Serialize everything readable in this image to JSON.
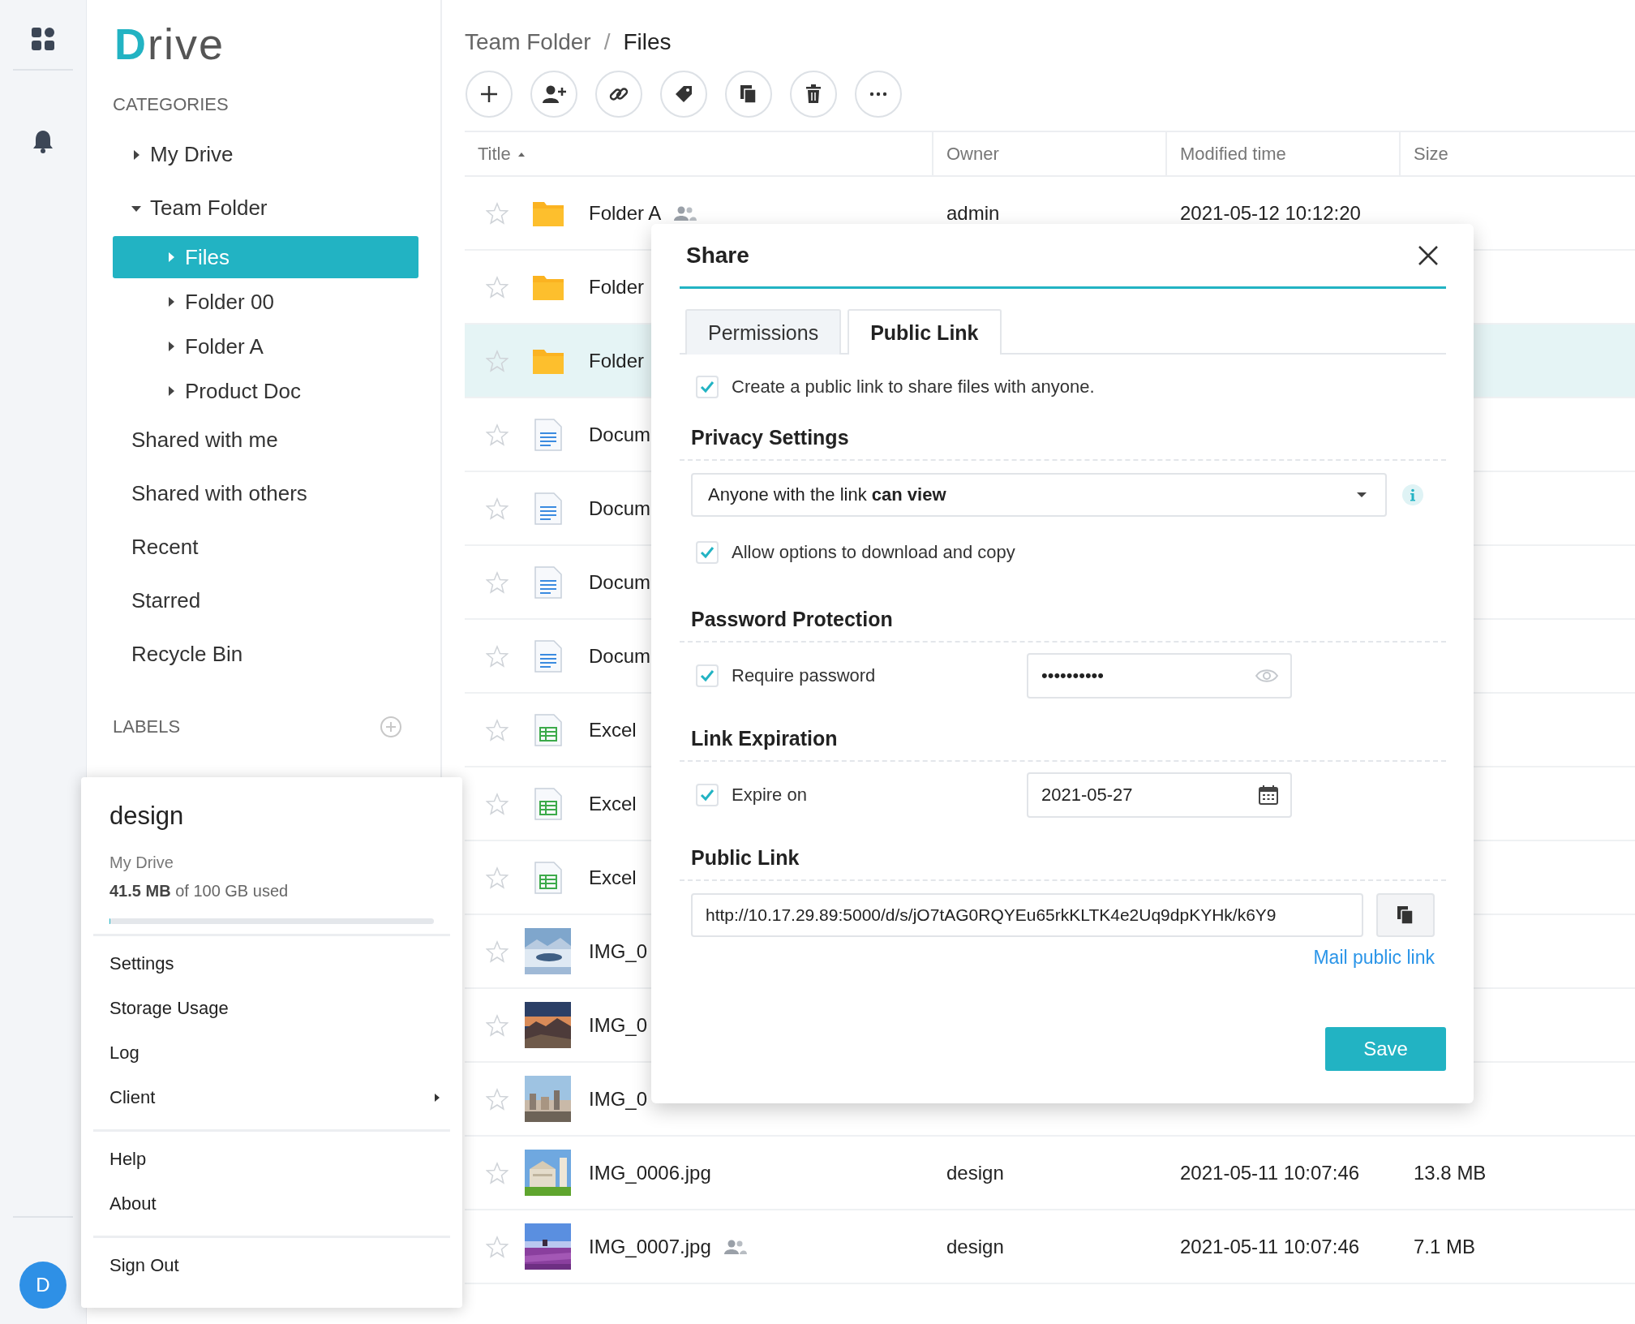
{
  "app": {
    "logo": "Drive",
    "avatar": "D"
  },
  "sidebar": {
    "categories_heading": "CATEGORIES",
    "labels_heading": "LABELS",
    "items": [
      {
        "label": "My Drive",
        "kind": "folder",
        "expanded": false,
        "selected": false
      },
      {
        "label": "Team Folder",
        "kind": "folder",
        "expanded": true,
        "selected": false,
        "children": [
          {
            "label": "Files",
            "kind": "folder",
            "expanded": false,
            "selected": true
          },
          {
            "label": "Folder 00",
            "kind": "folder",
            "expanded": false,
            "selected": false
          },
          {
            "label": "Folder A",
            "kind": "folder",
            "expanded": false,
            "selected": false
          },
          {
            "label": "Product Doc",
            "kind": "folder",
            "expanded": false,
            "selected": false
          }
        ]
      },
      {
        "label": "Shared with me",
        "kind": "link",
        "selected": false
      },
      {
        "label": "Shared with others",
        "kind": "link",
        "selected": false
      },
      {
        "label": "Recent",
        "kind": "link",
        "selected": false
      },
      {
        "label": "Starred",
        "kind": "link",
        "selected": false
      },
      {
        "label": "Recycle Bin",
        "kind": "link",
        "selected": false
      }
    ]
  },
  "breadcrumb": {
    "items": [
      "Team Folder",
      "Files"
    ],
    "separator": "/"
  },
  "toolbar": [
    {
      "kind": "add"
    },
    {
      "kind": "add-user"
    },
    {
      "kind": "link"
    },
    {
      "kind": "tag"
    },
    {
      "kind": "copy"
    },
    {
      "kind": "delete"
    },
    {
      "kind": "more"
    }
  ],
  "table": {
    "columns": [
      {
        "label": "Title",
        "sorted": true
      },
      {
        "label": "Owner",
        "sorted": false
      },
      {
        "label": "Modified time",
        "sorted": false
      },
      {
        "label": "Size",
        "sorted": false
      }
    ],
    "rows": [
      {
        "kind": "folder",
        "title": "Folder A",
        "shared": true,
        "owner": "admin",
        "modified": "2021-05-12 10:12:20",
        "selected": false
      },
      {
        "kind": "folder",
        "title": "Folder",
        "selected": false
      },
      {
        "kind": "folder",
        "title": "Folder",
        "selected": true
      },
      {
        "kind": "document",
        "title": "Docum",
        "selected": false
      },
      {
        "kind": "document",
        "title": "Docum",
        "selected": false
      },
      {
        "kind": "document",
        "title": "Docum",
        "selected": false
      },
      {
        "kind": "document",
        "title": "Docum",
        "selected": false
      },
      {
        "kind": "sheet",
        "title": "Excel",
        "selected": false
      },
      {
        "kind": "sheet",
        "title": "Excel",
        "selected": false
      },
      {
        "kind": "sheet",
        "title": "Excel",
        "selected": false
      },
      {
        "title": "IMG_0",
        "selected": false
      },
      {
        "title": "IMG_0",
        "selected": false
      },
      {
        "title": "IMG_0",
        "selected": false
      },
      {
        "title": "IMG_0006.jpg",
        "shared": false,
        "owner": "design",
        "modified": "2021-05-11 10:07:46",
        "size": "13.8 MB",
        "selected": false
      },
      {
        "title": "IMG_0007.jpg",
        "shared": true,
        "owner": "design",
        "modified": "2021-05-11 10:07:46",
        "size": "7.1 MB",
        "selected": false
      }
    ]
  },
  "share_dialog": {
    "title": "Share",
    "tabs": [
      {
        "label": "Permissions",
        "selected": false
      },
      {
        "label": "Public Link",
        "selected": true
      }
    ],
    "create_link": {
      "label": "Create a public link to share files with anyone.",
      "checked": true
    },
    "privacy": {
      "heading": "Privacy Settings",
      "value": "Anyone with the link **can view**",
      "allow_download": {
        "label": "Allow options to download and copy",
        "checked": true
      }
    },
    "password": {
      "heading": "Password Protection",
      "label": "Require password",
      "checked": true,
      "value": "••••••••••"
    },
    "expiration": {
      "heading": "Link Expiration",
      "label": "Expire on",
      "checked": true,
      "value": "2021-05-27"
    },
    "public_link": {
      "heading": "Public Link",
      "value": "http://10.17.29.89:5000/d/s/jO7tAG0RQYEu65rkKLTK4e2Uq9dpKYHk/k6Y9",
      "mail_link": "Mail public link"
    },
    "save": "Save"
  },
  "account_menu": {
    "name": "design",
    "drive": "My Drive",
    "usage": "**41.5 MB** of 100 GB used",
    "level": 0.0004,
    "groups": [
      {
        "items": [
          {
            "label": "Settings",
            "submenu": false
          },
          {
            "label": "Storage Usage",
            "submenu": false
          },
          {
            "label": "Log",
            "submenu": false
          },
          {
            "label": "Client",
            "submenu": true
          }
        ]
      },
      {
        "items": [
          {
            "label": "Help",
            "submenu": false
          },
          {
            "label": "About",
            "submenu": false
          }
        ]
      },
      {
        "items": [
          {
            "label": "Sign Out",
            "submenu": false
          }
        ]
      }
    ]
  }
}
